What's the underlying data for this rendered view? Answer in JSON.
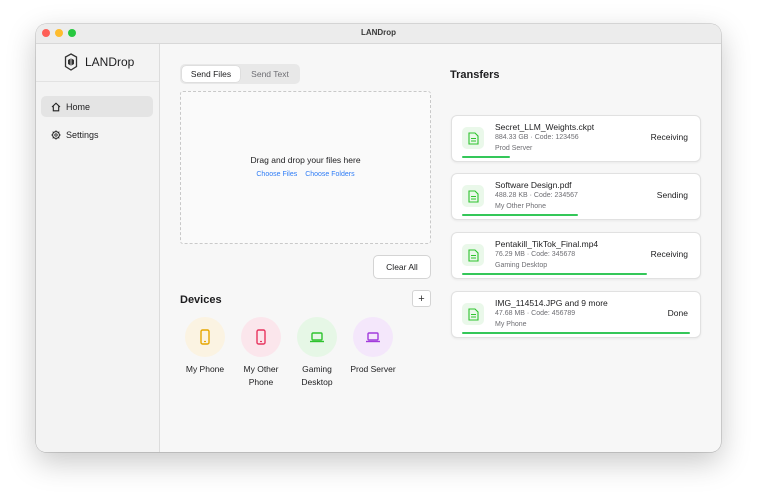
{
  "window": {
    "title": "LANDrop"
  },
  "sidebar": {
    "app_name": "LANDrop",
    "items": [
      {
        "label": "Home",
        "icon": "home-icon",
        "active": true
      },
      {
        "label": "Settings",
        "icon": "gear-icon",
        "active": false
      }
    ]
  },
  "send": {
    "tabs": [
      {
        "label": "Send Files",
        "active": true
      },
      {
        "label": "Send Text",
        "active": false
      }
    ],
    "drop_text": "Drag and drop your files here",
    "choose_files": "Choose Files",
    "choose_folders": "Choose Folders",
    "clear_all": "Clear All"
  },
  "devices": {
    "title": "Devices",
    "add_label": "+",
    "items": [
      {
        "name": "My Phone",
        "type": "phone",
        "color": "#e6a600",
        "bg": "#fbf3e2"
      },
      {
        "name": "My Other Phone",
        "type": "phone",
        "color": "#e8345e",
        "bg": "#fbe6ec"
      },
      {
        "name": "Gaming Desktop",
        "type": "laptop",
        "color": "#2ec32e",
        "bg": "#e6f7e6"
      },
      {
        "name": "Prod Server",
        "type": "laptop",
        "color": "#a23bdc",
        "bg": "#f4e7fb"
      }
    ]
  },
  "transfers": {
    "title": "Transfers",
    "items": [
      {
        "name": "Secret_LLM_Weights.ckpt",
        "meta": "884.33 GB · Code: 123456",
        "device": "Prod Server",
        "status": "Receiving",
        "progress": 0.21
      },
      {
        "name": "Software Design.pdf",
        "meta": "488.28 KB · Code: 234567",
        "device": "My Other Phone",
        "status": "Sending",
        "progress": 0.51
      },
      {
        "name": "Pentakill_TikTok_Final.mp4",
        "meta": "76.29 MB · Code: 345678",
        "device": "Gaming Desktop",
        "status": "Receiving",
        "progress": 0.81
      },
      {
        "name": "IMG_114514.JPG and 9 more",
        "meta": "47.68 MB · Code: 456789",
        "device": "My Phone",
        "status": "Done",
        "progress": 1.0
      }
    ]
  },
  "colors": {
    "accent": "#2e7cf6",
    "progress": "#34c759",
    "file_icon": "#2ec32e"
  }
}
